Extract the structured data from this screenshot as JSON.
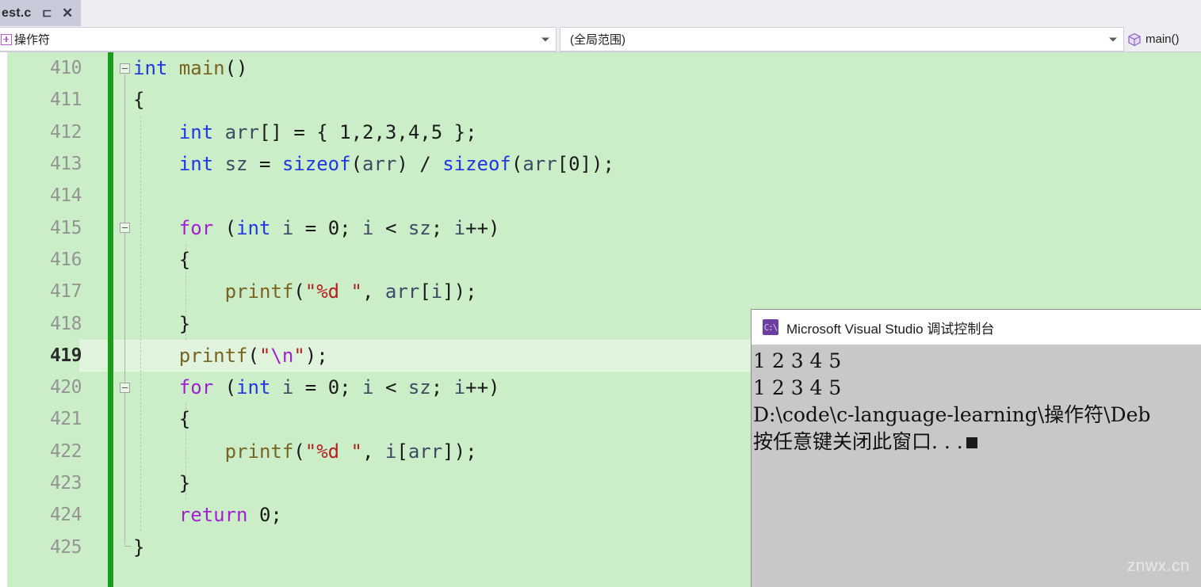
{
  "tab": {
    "title": "est.c",
    "pin_icon": "pin-icon",
    "close_icon": "close-icon"
  },
  "navbar": {
    "project_combo": {
      "value": "操作符",
      "icon": "project-box-icon",
      "arrow_icon": "chevron-down-icon"
    },
    "scope_combo": {
      "value": "(全局范围)",
      "arrow_icon": "chevron-down-icon"
    },
    "method": {
      "value": "main()",
      "icon": "method-cube-icon"
    }
  },
  "editor": {
    "first_line": 410,
    "current_line": 419,
    "lines": [
      {
        "num": "410",
        "fold": "minus",
        "indent": 0,
        "tokens": [
          {
            "t": "int ",
            "c": "k-type"
          },
          {
            "t": "main",
            "c": "fn"
          },
          {
            "t": "()",
            "c": "plain"
          }
        ]
      },
      {
        "num": "411",
        "fold": "",
        "indent": 0,
        "tokens": [
          {
            "t": "{",
            "c": "plain"
          }
        ]
      },
      {
        "num": "412",
        "fold": "",
        "indent": 1,
        "tokens": [
          {
            "t": "    ",
            "c": "plain"
          },
          {
            "t": "int",
            "c": "k-type"
          },
          {
            "t": " ",
            "c": "plain"
          },
          {
            "t": "arr",
            "c": "ident"
          },
          {
            "t": "[] = { ",
            "c": "plain"
          },
          {
            "t": "1,2,3,4,5",
            "c": "num"
          },
          {
            "t": " };",
            "c": "plain"
          }
        ]
      },
      {
        "num": "413",
        "fold": "",
        "indent": 1,
        "tokens": [
          {
            "t": "    ",
            "c": "plain"
          },
          {
            "t": "int",
            "c": "k-type"
          },
          {
            "t": " ",
            "c": "plain"
          },
          {
            "t": "sz",
            "c": "ident"
          },
          {
            "t": " = ",
            "c": "plain"
          },
          {
            "t": "sizeof",
            "c": "k-type"
          },
          {
            "t": "(",
            "c": "plain"
          },
          {
            "t": "arr",
            "c": "ident"
          },
          {
            "t": ") / ",
            "c": "plain"
          },
          {
            "t": "sizeof",
            "c": "k-type"
          },
          {
            "t": "(",
            "c": "plain"
          },
          {
            "t": "arr",
            "c": "ident"
          },
          {
            "t": "[",
            "c": "plain"
          },
          {
            "t": "0",
            "c": "num"
          },
          {
            "t": "]);",
            "c": "plain"
          }
        ]
      },
      {
        "num": "414",
        "fold": "",
        "indent": 1,
        "tokens": []
      },
      {
        "num": "415",
        "fold": "minus",
        "indent": 1,
        "tokens": [
          {
            "t": "    ",
            "c": "plain"
          },
          {
            "t": "for",
            "c": "k-ctrl"
          },
          {
            "t": " (",
            "c": "plain"
          },
          {
            "t": "int",
            "c": "k-type"
          },
          {
            "t": " ",
            "c": "plain"
          },
          {
            "t": "i",
            "c": "ident"
          },
          {
            "t": " = ",
            "c": "plain"
          },
          {
            "t": "0",
            "c": "num"
          },
          {
            "t": "; ",
            "c": "plain"
          },
          {
            "t": "i",
            "c": "ident"
          },
          {
            "t": " < ",
            "c": "plain"
          },
          {
            "t": "sz",
            "c": "ident"
          },
          {
            "t": "; ",
            "c": "plain"
          },
          {
            "t": "i",
            "c": "ident"
          },
          {
            "t": "++)",
            "c": "plain"
          }
        ]
      },
      {
        "num": "416",
        "fold": "",
        "indent": 1,
        "tokens": [
          {
            "t": "    {",
            "c": "plain"
          }
        ]
      },
      {
        "num": "417",
        "fold": "",
        "indent": 2,
        "tokens": [
          {
            "t": "        ",
            "c": "plain"
          },
          {
            "t": "printf",
            "c": "fn"
          },
          {
            "t": "(",
            "c": "plain"
          },
          {
            "t": "\"%d \"",
            "c": "str"
          },
          {
            "t": ", ",
            "c": "plain"
          },
          {
            "t": "arr",
            "c": "ident"
          },
          {
            "t": "[",
            "c": "plain"
          },
          {
            "t": "i",
            "c": "ident"
          },
          {
            "t": "]);",
            "c": "plain"
          }
        ]
      },
      {
        "num": "418",
        "fold": "",
        "indent": 1,
        "tokens": [
          {
            "t": "    }",
            "c": "plain"
          }
        ]
      },
      {
        "num": "419",
        "fold": "",
        "indent": 1,
        "current": true,
        "tokens": [
          {
            "t": "    ",
            "c": "plain"
          },
          {
            "t": "printf",
            "c": "fn"
          },
          {
            "t": "(",
            "c": "plain"
          },
          {
            "t": "\"",
            "c": "str"
          },
          {
            "t": "\\n",
            "c": "esc"
          },
          {
            "t": "\"",
            "c": "str"
          },
          {
            "t": ");",
            "c": "plain"
          }
        ]
      },
      {
        "num": "420",
        "fold": "minus",
        "indent": 1,
        "tokens": [
          {
            "t": "    ",
            "c": "plain"
          },
          {
            "t": "for",
            "c": "k-ctrl"
          },
          {
            "t": " (",
            "c": "plain"
          },
          {
            "t": "int",
            "c": "k-type"
          },
          {
            "t": " ",
            "c": "plain"
          },
          {
            "t": "i",
            "c": "ident"
          },
          {
            "t": " = ",
            "c": "plain"
          },
          {
            "t": "0",
            "c": "num"
          },
          {
            "t": "; ",
            "c": "plain"
          },
          {
            "t": "i",
            "c": "ident"
          },
          {
            "t": " < ",
            "c": "plain"
          },
          {
            "t": "sz",
            "c": "ident"
          },
          {
            "t": "; ",
            "c": "plain"
          },
          {
            "t": "i",
            "c": "ident"
          },
          {
            "t": "++)",
            "c": "plain"
          }
        ]
      },
      {
        "num": "421",
        "fold": "",
        "indent": 1,
        "tokens": [
          {
            "t": "    {",
            "c": "plain"
          }
        ]
      },
      {
        "num": "422",
        "fold": "",
        "indent": 2,
        "tokens": [
          {
            "t": "        ",
            "c": "plain"
          },
          {
            "t": "printf",
            "c": "fn"
          },
          {
            "t": "(",
            "c": "plain"
          },
          {
            "t": "\"%d \"",
            "c": "str"
          },
          {
            "t": ", ",
            "c": "plain"
          },
          {
            "t": "i",
            "c": "ident"
          },
          {
            "t": "[",
            "c": "plain"
          },
          {
            "t": "arr",
            "c": "ident"
          },
          {
            "t": "]);",
            "c": "plain"
          }
        ]
      },
      {
        "num": "423",
        "fold": "",
        "indent": 1,
        "tokens": [
          {
            "t": "    }",
            "c": "plain"
          }
        ]
      },
      {
        "num": "424",
        "fold": "",
        "indent": 1,
        "tokens": [
          {
            "t": "    ",
            "c": "plain"
          },
          {
            "t": "return",
            "c": "k-ctrl"
          },
          {
            "t": " ",
            "c": "plain"
          },
          {
            "t": "0",
            "c": "num"
          },
          {
            "t": ";",
            "c": "plain"
          }
        ]
      },
      {
        "num": "425",
        "fold": "",
        "indent": 0,
        "tokens": [
          {
            "t": "}",
            "c": "plain"
          }
        ]
      }
    ]
  },
  "console": {
    "icon": "cmd-icon",
    "icon_text": "C:\\",
    "title": "Microsoft Visual Studio 调试控制台",
    "output": [
      "1 2 3 4 5",
      "1 2 3 4 5",
      "D:\\code\\c-language-learning\\操作符\\Deb",
      "按任意键关闭此窗口. . ."
    ]
  },
  "watermark": {
    "text": "znwx.cn"
  },
  "colors": {
    "editor_bg": "#cbeec9",
    "current_line_bg": "#dff3dd",
    "change_bar": "#1a9c1a",
    "console_bg": "#c8c8c8",
    "keyword_type": "#1f38e0",
    "keyword_ctrl": "#a21fd1",
    "function": "#7a6320",
    "string": "#b32020",
    "identifier": "#3e4a63",
    "linenumber": "#949494",
    "tab_bg": "#c9cbda",
    "chrome_bg": "#eeeef2"
  }
}
